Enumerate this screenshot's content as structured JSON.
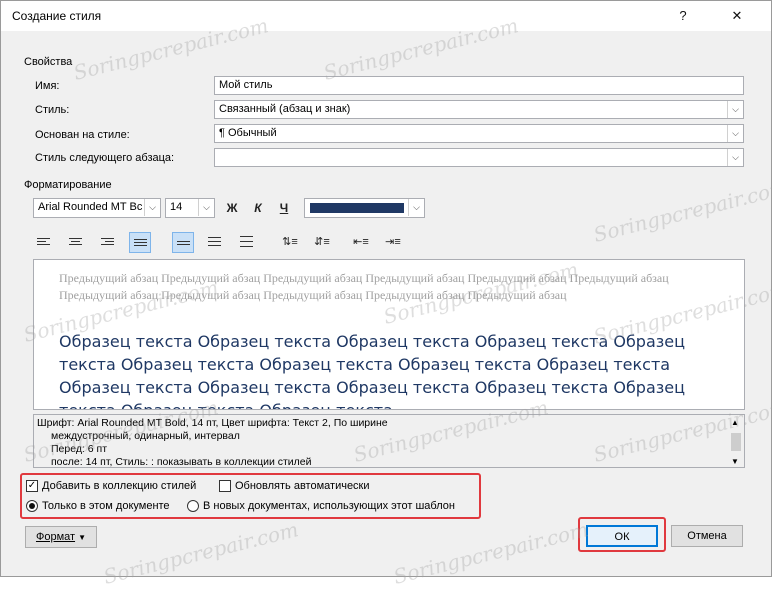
{
  "window": {
    "title": "Создание стиля",
    "help": "?",
    "close": "✕"
  },
  "properties": {
    "section": "Свойства",
    "name_label": "Имя:",
    "name_value": "Мой стиль",
    "type_label": "Стиль:",
    "type_value": "Связанный (абзац и знак)",
    "based_label": "Основан на стиле:",
    "based_value": "¶  Обычный",
    "next_label": "Стиль следующего абзаца:",
    "next_value": ""
  },
  "formatting": {
    "section": "Форматирование",
    "font": "Arial Rounded MT Bc",
    "size": "14",
    "bold": "Ж",
    "italic": "К",
    "underline": "Ч",
    "font_color": "#1f3864"
  },
  "preview": {
    "previous": "Предыдущий абзац Предыдущий абзац Предыдущий абзац Предыдущий абзац Предыдущий абзац Предыдущий абзац Предыдущий абзац Предыдущий абзац Предыдущий абзац Предыдущий абзац Предыдущий абзац",
    "sample": "Образец текста Образец текста Образец текста Образец текста Образец текста Образец текста Образец текста Образец текста Образец текста Образец текста Образец текста Образец текста Образец текста Образец текста Образец текста Образец текста"
  },
  "description": {
    "line1": "Шрифт: Arial Rounded MT Bold, 14 пт, Цвет шрифта: Текст 2, По ширине",
    "line2": "междустрочный,  одинарный, интервал",
    "line3": "Перед:  6 пт",
    "line4": "после: 14 пт, Стиль: : показывать в коллекции стилей"
  },
  "options": {
    "add_gallery": "Добавить в коллекцию стилей",
    "auto_update": "Обновлять автоматически",
    "only_doc": "Только в этом документе",
    "new_docs": "В новых документах, использующих этот шаблон"
  },
  "buttons": {
    "format": "Формат",
    "ok": "ОК",
    "cancel": "Отмена"
  },
  "watermark": "Soringpcrepair.com",
  "colors": {
    "highlight": "#e0393e",
    "active_tool": "#c9e0f7"
  }
}
